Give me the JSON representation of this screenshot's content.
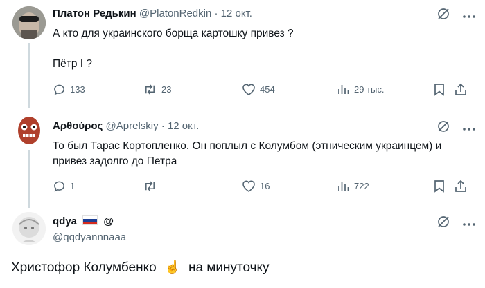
{
  "tweets": [
    {
      "name": "Платон Редькин",
      "handle": "@PlatonRedkin",
      "sep": "·",
      "date": "12 окт.",
      "text_line1": "А кто для украинского борща картошку привез ?",
      "text_line2": "Пётр I ?",
      "replies": "133",
      "reposts": "23",
      "likes": "454",
      "views": "29 тыс."
    },
    {
      "name": "Αρθούρος",
      "handle": "@Aprelskiy",
      "sep": "·",
      "date": "12 окт.",
      "text": "То был Тарас Кортопленко. Он поплыл с Колумбом (этническим украинцем) и привез задолго до Петра",
      "replies": "1",
      "reposts": "",
      "likes": "16",
      "views": "722"
    },
    {
      "name": "qdya",
      "at_symbol": "@",
      "handle": "@qqdyannnaaa",
      "text_before": "Христофор Колумбенко",
      "emoji": "☝",
      "text_after": "на минуточку"
    }
  ],
  "icons": {
    "grok": "grok-icon",
    "more": "more-icon",
    "reply": "reply-icon",
    "repost": "repost-icon",
    "like": "like-icon",
    "views": "views-icon",
    "bookmark": "bookmark-icon",
    "share": "share-icon"
  },
  "colors": {
    "text": "#0f1419",
    "muted": "#536471",
    "line": "#cfd9de"
  }
}
